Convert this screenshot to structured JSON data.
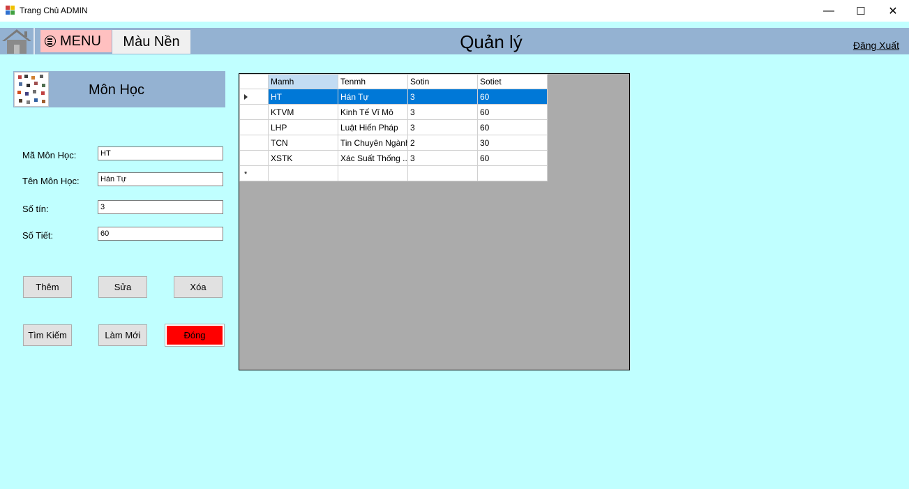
{
  "window": {
    "title": "Trang Chủ ADMIN",
    "minimize": "—",
    "maximize": "☐",
    "close": "✕"
  },
  "header": {
    "menu_label": "MENU",
    "background_label": "Màu Nền",
    "title": "Quản lý",
    "logout_label": "Đăng Xuất"
  },
  "subject_panel": {
    "title": "Môn Học"
  },
  "form": {
    "code_label": "Mã Môn Học:",
    "code_value": "HT",
    "name_label": "Tên Môn Học:",
    "name_value": "Hán Tự",
    "credits_label": "Số tín:",
    "credits_value": "3",
    "periods_label": "Số Tiết:",
    "periods_value": "60"
  },
  "buttons": {
    "add": "Thêm",
    "edit": "Sửa",
    "delete": "Xóa",
    "search": "Tìm Kiếm",
    "refresh": "Làm Mới",
    "close": "Đóng"
  },
  "grid": {
    "columns": [
      "Mamh",
      "Tenmh",
      "Sotin",
      "Sotiet"
    ],
    "rows": [
      [
        "HT",
        "Hán Tự",
        "3",
        "60"
      ],
      [
        "KTVM",
        "Kinh Tế Vĩ Mô",
        "3",
        "60"
      ],
      [
        "LHP",
        "Luật Hiến Pháp",
        "3",
        "60"
      ],
      [
        "TCN",
        "Tin Chuyên Ngành",
        "2",
        "30"
      ],
      [
        "XSTK",
        "Xác Suất Thống ...",
        "3",
        "60"
      ]
    ],
    "new_row_marker": "*"
  },
  "colors": {
    "background": "#c0ffff",
    "header": "#94b2d2",
    "menu_button": "#ffc0c0",
    "close_button": "#ff0000",
    "selection": "#0078d7"
  }
}
